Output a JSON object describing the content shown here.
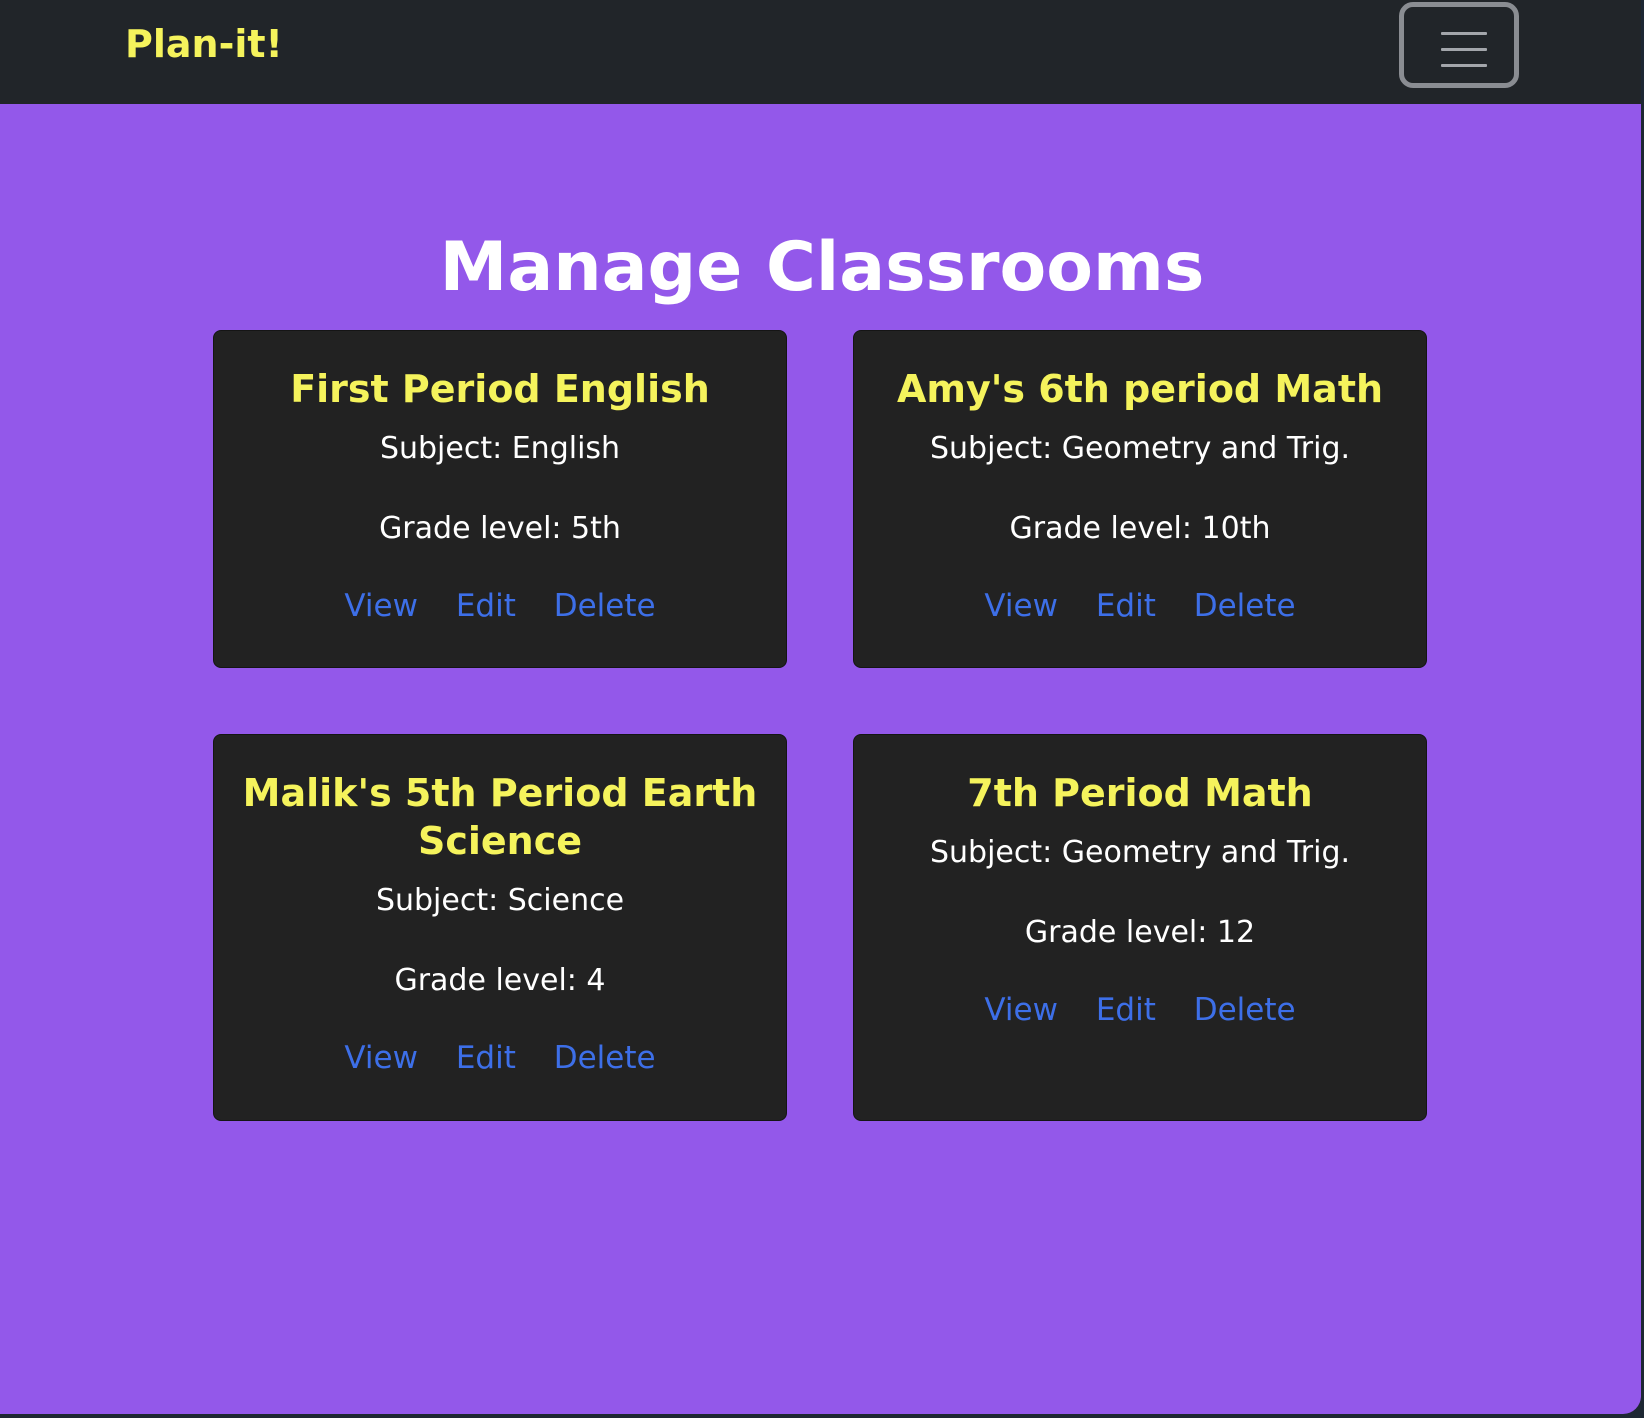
{
  "navbar": {
    "brand": "Plan-it!",
    "toggler_icon": "hamburger-menu-icon"
  },
  "page": {
    "title": "Manage Classrooms"
  },
  "classrooms": [
    {
      "name": "First Period English",
      "subject": "Subject: English",
      "grade": "Grade level: 5th",
      "view_label": "View",
      "edit_label": "Edit",
      "delete_label": "Delete"
    },
    {
      "name": "Amy's 6th period Math",
      "subject": "Subject: Geometry and Trig.",
      "grade": "Grade level: 10th",
      "view_label": "View",
      "edit_label": "Edit",
      "delete_label": "Delete"
    },
    {
      "name": "Malik's 5th Period Earth Science",
      "subject": "Subject: Science",
      "grade": "Grade level: 4",
      "view_label": "View",
      "edit_label": "Edit",
      "delete_label": "Delete"
    },
    {
      "name": "7th Period Math",
      "subject": "Subject: Geometry and Trig.",
      "grade": "Grade level: 12",
      "view_label": "View",
      "edit_label": "Edit",
      "delete_label": "Delete"
    }
  ],
  "colors": {
    "page_background": "#9358ea",
    "navbar_background": "#212529",
    "card_background": "#222222",
    "brand_yellow": "#f5f35c",
    "link_blue": "#3d6fe8",
    "text_white": "#ffffff"
  }
}
